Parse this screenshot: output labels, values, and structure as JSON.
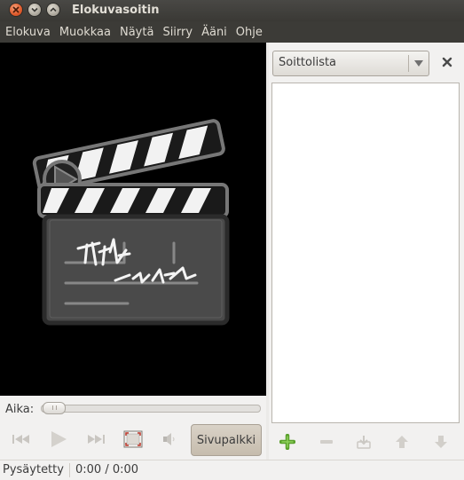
{
  "window": {
    "title": "Elokuvasoitin"
  },
  "menubar": {
    "items": [
      "Elokuva",
      "Muokkaa",
      "Näytä",
      "Siirry",
      "Ääni",
      "Ohje"
    ]
  },
  "controls": {
    "time_label": "Aika:",
    "seek_fraction": 0.0,
    "sidebar_button": "Sivupalkki",
    "buttons": [
      "previous-icon",
      "play-icon",
      "next-icon",
      "fullscreen-icon",
      "volume-icon"
    ]
  },
  "sidepane": {
    "combo_value": "Soittolista",
    "playlist_buttons": [
      "add-icon",
      "remove-icon",
      "save-icon",
      "move-up-icon",
      "move-down-icon"
    ]
  },
  "statusbar": {
    "state": "Pysäytetty",
    "time": "0:00 / 0:00"
  },
  "colors": {
    "title_bar": "#3c3b37",
    "close_button": "#e05a2b",
    "add_green": "#5aa02c",
    "video_bg": "#000000"
  }
}
